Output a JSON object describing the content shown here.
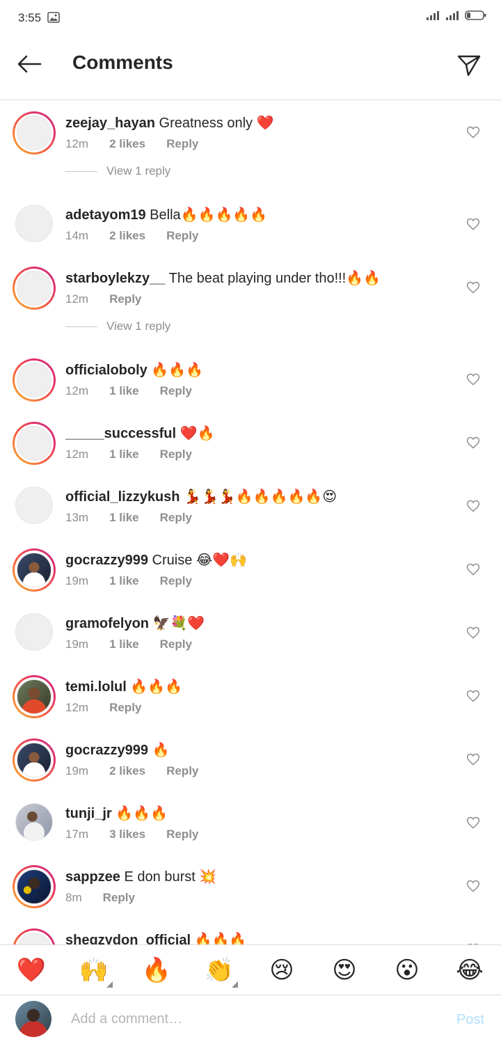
{
  "status_bar": {
    "time": "3:55"
  },
  "header": {
    "title": "Comments"
  },
  "comments": [
    {
      "user": "zeejay_hayan",
      "text": "Greatness only ❤️",
      "time": "12m",
      "likes": "2 likes",
      "reply": "Reply",
      "ring": true,
      "avatar": "",
      "view_replies": "View 1 reply"
    },
    {
      "user": "adetayom19",
      "text": "Bella🔥🔥🔥🔥🔥",
      "time": "14m",
      "likes": "2 likes",
      "reply": "Reply",
      "ring": false,
      "avatar": ""
    },
    {
      "user": "starboylekzy__",
      "text": "The beat playing under tho!!!🔥🔥",
      "time": "12m",
      "likes": "",
      "reply": "Reply",
      "ring": true,
      "avatar": "",
      "view_replies": "View 1 reply"
    },
    {
      "user": "officialoboly",
      "text": "🔥🔥🔥",
      "time": "12m",
      "likes": "1 like",
      "reply": "Reply",
      "ring": true,
      "avatar": ""
    },
    {
      "user": "_____successful",
      "text": "❤️🔥",
      "time": "12m",
      "likes": "1 like",
      "reply": "Reply",
      "ring": true,
      "avatar": ""
    },
    {
      "user": "official_lizzykush",
      "text": "💃💃💃🔥🔥🔥🔥🔥😍",
      "time": "13m",
      "likes": "1 like",
      "reply": "Reply",
      "ring": false,
      "avatar": ""
    },
    {
      "user": "gocrazzy999",
      "text": "Cruise 😂❤️🙌",
      "time": "19m",
      "likes": "1 like",
      "reply": "Reply",
      "ring": true,
      "avatar": "photo-a"
    },
    {
      "user": "gramofelyon",
      "text": "🦅💐❤️",
      "time": "19m",
      "likes": "1 like",
      "reply": "Reply",
      "ring": false,
      "avatar": ""
    },
    {
      "user": "temi.lolul",
      "text": "🔥🔥🔥",
      "time": "12m",
      "likes": "",
      "reply": "Reply",
      "ring": true,
      "avatar": "photo-b"
    },
    {
      "user": "gocrazzy999",
      "text": "🔥",
      "time": "19m",
      "likes": "2 likes",
      "reply": "Reply",
      "ring": true,
      "avatar": "photo-a"
    },
    {
      "user": "tunji_jr",
      "text": "🔥🔥🔥",
      "time": "17m",
      "likes": "3 likes",
      "reply": "Reply",
      "ring": false,
      "avatar": "photo-c"
    },
    {
      "user": "sappzee",
      "text": "E don burst 💥",
      "time": "8m",
      "likes": "",
      "reply": "Reply",
      "ring": true,
      "avatar": "photo-d"
    },
    {
      "user": "sheqzydon_official",
      "text": "🔥🔥🔥",
      "time": "",
      "likes": "",
      "reply": "",
      "ring": true,
      "avatar": ""
    }
  ],
  "quick_reactions": [
    "❤️",
    "🙌",
    "🔥",
    "👏",
    "😢",
    "😍",
    "😮",
    "😂"
  ],
  "input": {
    "placeholder": "Add a comment…",
    "post_label": "Post"
  },
  "colors": {
    "post_disabled": "#b2dffc",
    "text_secondary": "#8e8e8e",
    "heart_red": "#ed4956"
  }
}
